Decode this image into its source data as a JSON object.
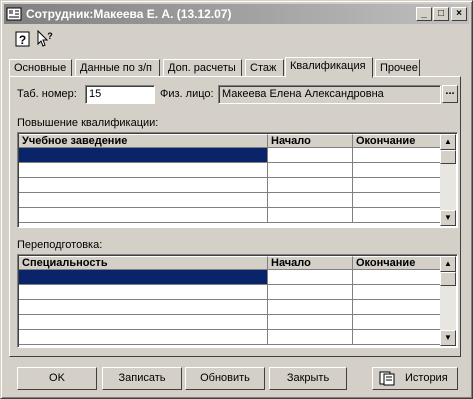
{
  "window": {
    "title": "Сотрудник:Макеева Е. А. (13.12.07)"
  },
  "caption_buttons": {
    "minimize": "_",
    "maximize": "□",
    "close": "×"
  },
  "toolbar": {
    "help_icon": "question-icon",
    "whatsthis_icon": "arrow-question-icon"
  },
  "tabs": [
    {
      "label": "Основные"
    },
    {
      "label": "Данные по з/п"
    },
    {
      "label": "Доп. расчеты"
    },
    {
      "label": "Стаж"
    },
    {
      "label": "Квалификация"
    },
    {
      "label": "Прочее"
    }
  ],
  "active_tab": "Квалификация",
  "form": {
    "tab_number_label": "Таб. номер:",
    "tab_number_value": "15",
    "person_label": "Физ. лицо:",
    "person_value": "Макеева Елена Александровна",
    "lookup_button": "..."
  },
  "qualification": {
    "section_label": "Повышение квалификации:",
    "columns": [
      "Учебное заведение",
      "Начало",
      "Окончание"
    ]
  },
  "retraining": {
    "section_label": "Переподготовка:",
    "columns": [
      "Специальность",
      "Начало",
      "Окончание"
    ]
  },
  "buttons": {
    "ok": "OK",
    "save": "Записать",
    "refresh": "Обновить",
    "close": "Закрыть",
    "history": "История"
  },
  "colors": {
    "selection": "#0a246a",
    "face": "#d4d0c8"
  }
}
